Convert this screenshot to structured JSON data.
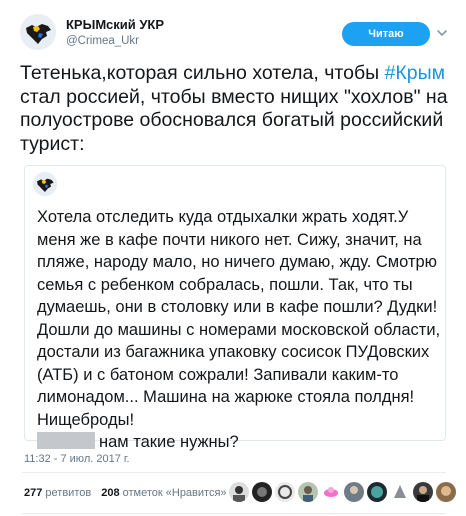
{
  "author": {
    "name": "КРЫМский УКР",
    "handle": "@Crimea_Ukr",
    "avatar_icon": "crimea-map-avatar-icon"
  },
  "follow_button": {
    "label": "Читаю"
  },
  "tweet": {
    "text_before": "Тетенька,которая сильно хотела, чтобы ",
    "hashtag": "#Крым",
    "text_after": " стал россией, чтобы вместо нищих \"хохлов\" на полуострове обосновался богатый российский турист:"
  },
  "quote": {
    "avatar_icon": "crimea-map-avatar-icon",
    "text": "Хотела отследить куда отдыхалки жрать ходят.У меня же в кафе почти никого нет. Сижу, значит, на пляже, народу мало, но ничего думаю, жду. Смотрю семья с ребенком собралась, пошли. Так, что ты думаешь, они в столовку или в кафе пошли? Дудки! Дошли до машины с номерами московской области, достали из багажника упаковку сосисок ПУДовских (АТБ) и с батоном сожрали! Запивали каким-то лимонадом... Машина на жарюке стояла полдня!Нищеброды!",
    "last_line": "нам такие нужны?"
  },
  "timestamp": "11:32 - 7 июл. 2017 г.",
  "stats": {
    "retweets_count": "277",
    "retweets_label": "ретвитов",
    "likes_count": "208",
    "likes_label": "отметок «Нравится»"
  },
  "colors": {
    "accent": "#1da1f2",
    "hashtag": "#1b95e0",
    "secondary_text": "#657786",
    "border": "#e1e8ed"
  }
}
